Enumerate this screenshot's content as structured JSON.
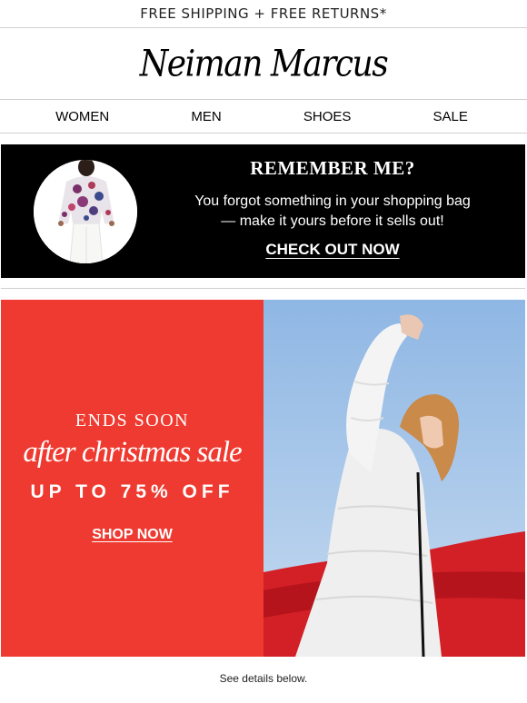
{
  "promo_bar": {
    "text": "FREE SHIPPING + FREE RETURNS*"
  },
  "brand": {
    "logo_text": "Neiman Marcus"
  },
  "nav": {
    "items": [
      "WOMEN",
      "MEN",
      "SHOES",
      "SALE"
    ]
  },
  "reminder": {
    "title": "REMEMBER ME?",
    "body_line1": "You forgot something in your shopping bag",
    "body_line2": "— make it yours before it sells out!",
    "cta": "CHECK OUT NOW",
    "product_image": "floral-blouse-product-photo"
  },
  "hero": {
    "kicker": "ENDS SOON",
    "headline": "after christmas sale",
    "offer": "UP TO 75% OFF",
    "cta": "SHOP NOW",
    "background_color": "#ee3a30",
    "image": "model-in-white-puffer-coat-photo"
  },
  "footer": {
    "note": "See details below."
  }
}
